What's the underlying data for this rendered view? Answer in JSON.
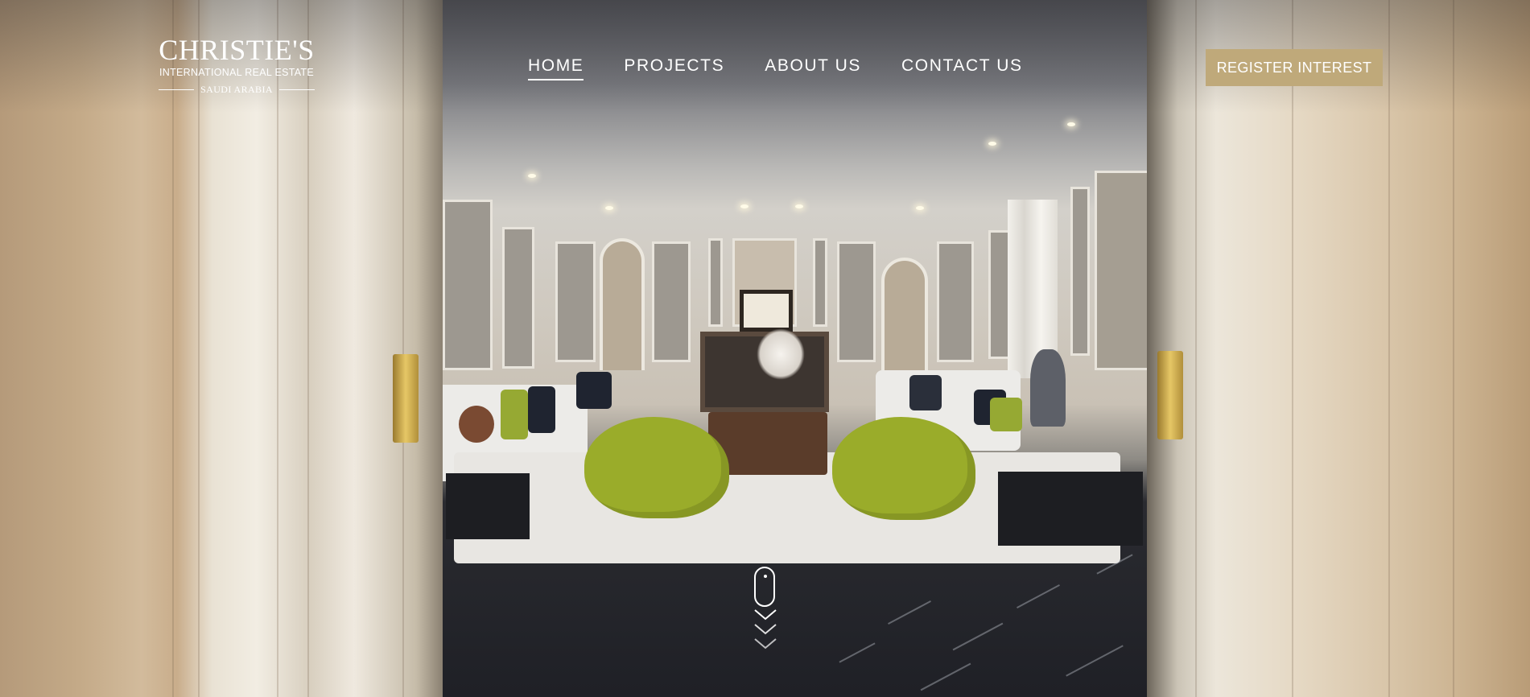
{
  "brand": {
    "name": "CHRISTIE'S",
    "subtitle": "INTERNATIONAL REAL ESTATE",
    "region": "SAUDI ARABIA"
  },
  "nav": {
    "items": [
      {
        "label": "HOME",
        "active": true
      },
      {
        "label": "PROJECTS",
        "active": false
      },
      {
        "label": "ABOUT US",
        "active": false
      },
      {
        "label": "CONTACT US",
        "active": false
      }
    ]
  },
  "cta": {
    "label": "REGISTER INTEREST",
    "color": "#bfa97a"
  },
  "hero": {
    "image": "luxury-living-room-through-open-doors"
  },
  "scroll_indicator": {
    "icon": "mouse-scroll-icon",
    "arrows": "chevron-down-icon"
  }
}
